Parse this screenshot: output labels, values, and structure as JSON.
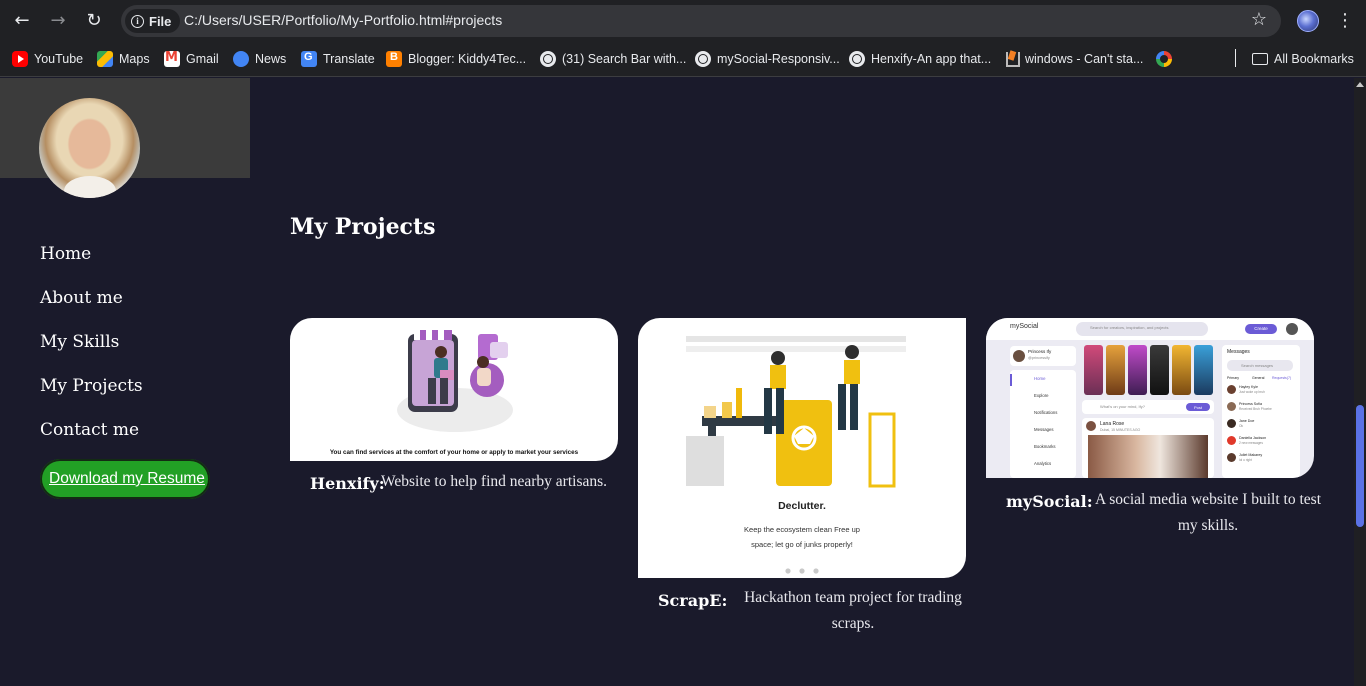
{
  "browser": {
    "back_icon": "arrow-left-icon",
    "forward_icon": "arrow-right-icon",
    "reload_icon": "reload-icon",
    "site_chip": "File",
    "url": "C:/Users/USER/Portfolio/My-Portfolio.html#projects",
    "star_icon": "star-icon",
    "menu_icon": "kebab-menu-icon"
  },
  "bookmarks": [
    {
      "label": "YouTube",
      "icon": "youtube-icon"
    },
    {
      "label": "Maps",
      "icon": "maps-icon"
    },
    {
      "label": "Gmail",
      "icon": "gmail-icon"
    },
    {
      "label": "News",
      "icon": "news-icon"
    },
    {
      "label": "Translate",
      "icon": "translate-icon"
    },
    {
      "label": "Blogger: Kiddy4Tec...",
      "icon": "blogger-icon"
    },
    {
      "label": "(31) Search Bar with...",
      "icon": "globe-icon"
    },
    {
      "label": "mySocial-Responsiv...",
      "icon": "globe-icon"
    },
    {
      "label": "Henxify-An app that...",
      "icon": "globe-icon"
    },
    {
      "label": "windows - Can't sta...",
      "icon": "stackoverflow-icon"
    },
    {
      "label": "",
      "icon": "google-icon"
    }
  ],
  "all_bookmarks": "All Bookmarks",
  "sidebar": {
    "nav": [
      "Home",
      "About me",
      "My Skills",
      "My Projects",
      "Contact me"
    ],
    "resume_button": "Download my Resume",
    "resume_color": "#22a025"
  },
  "projects": {
    "title": "My Projects",
    "items": [
      {
        "name": "Henxify:",
        "description": "Website to help find nearby artisans.",
        "image_caption": "You can find services at the comfort of your home or apply to market your services"
      },
      {
        "name": "ScrapE:",
        "description": "Hackathon team project for trading scraps.",
        "image_title": "Declutter.",
        "image_text": "Keep the ecosystem clean Free up space; let go of junks properly!"
      },
      {
        "name": "mySocial:",
        "description": "A social media website I built to test my skills.",
        "image_brand": "mySocial",
        "image_search": "Search for creators, inspiration, and projects",
        "image_create": "Create",
        "image_profile_name": "Princess Ify",
        "image_profile_handle": "@princessify",
        "image_menu": [
          "Home",
          "Explore",
          "Notifications",
          "Messages",
          "Bookmarks",
          "Analytics"
        ],
        "image_messages_title": "Messages",
        "image_messages_search": "Search messages",
        "image_messages_tabs": [
          "Primary",
          "General",
          "Requests(7)"
        ],
        "image_post_prompt": "What's on your mind, Ify?",
        "image_post_button": "Post",
        "image_post_author": "Lana Rose",
        "image_post_meta": "Dubai, 15 MINUTES AGO",
        "image_contacts": [
          {
            "name": "Hayley Kyle",
            "msg": "Just woke up bruh"
          },
          {
            "name": "Princess Sofia",
            "msg": "Received Bruh Phoebe"
          },
          {
            "name": "Jane Doe",
            "msg": "Ok"
          },
          {
            "name": "Daniella Jackson",
            "msg": "2 new messages"
          },
          {
            "name": "Juliet Makarey",
            "msg": "lol u right"
          }
        ]
      }
    ]
  },
  "colors": {
    "page_bg": "#1a1a2b",
    "sidebar_header": "#3b3b3b",
    "accent_scroll": "#5b72e6"
  }
}
